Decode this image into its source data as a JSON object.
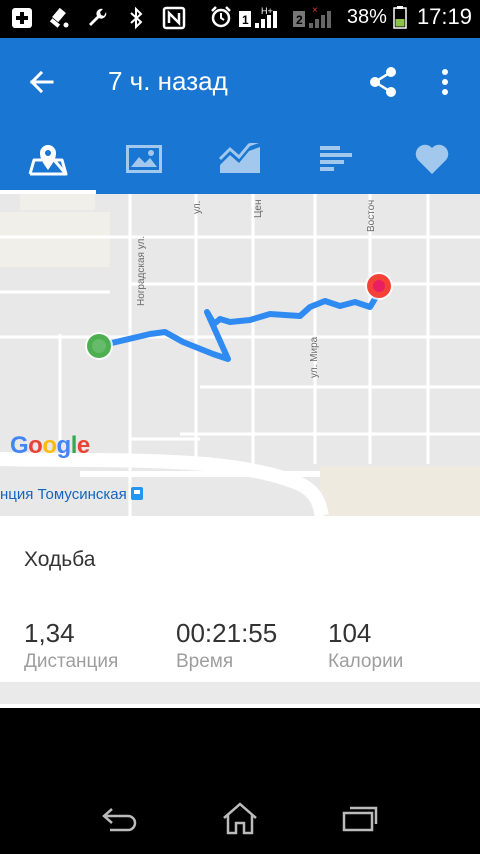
{
  "status_bar": {
    "battery_percent": "38%",
    "time": "17:19",
    "sim1": "1",
    "sim2": "2",
    "network": "H+",
    "icons": [
      "add-icon",
      "satellite-icon",
      "wrench-icon",
      "bluetooth-icon",
      "nfc-icon",
      "alarm-icon",
      "signal-icon",
      "battery-icon"
    ]
  },
  "app_bar": {
    "title": "7 ч. назад",
    "back_icon": "arrow-back-icon",
    "share_icon": "share-icon",
    "more_icon": "more-vert-icon"
  },
  "tabs": [
    {
      "name": "map",
      "icon": "map-icon",
      "active": true
    },
    {
      "name": "photos",
      "icon": "image-icon",
      "active": false
    },
    {
      "name": "charts",
      "icon": "chart-icon",
      "active": false
    },
    {
      "name": "laps",
      "icon": "bars-icon",
      "active": false
    },
    {
      "name": "heart",
      "icon": "heart-icon",
      "active": false
    }
  ],
  "map": {
    "streets": [
      "ул.",
      "Цен",
      "Восточ",
      "Ноградская ул.",
      "ул. Мира"
    ],
    "station": "нция Томусинская",
    "logo": "Google",
    "start_color": "#4CAF50",
    "end_color": "#F44336",
    "route_color": "#2F8BF2"
  },
  "details": {
    "activity": "Ходьба",
    "stats": [
      {
        "value": "1,34",
        "label": "Дистанция"
      },
      {
        "value": "00:21:55",
        "label": "Время"
      },
      {
        "value": "104",
        "label": "Калории"
      }
    ]
  },
  "colors": {
    "primary": "#1976D2"
  }
}
